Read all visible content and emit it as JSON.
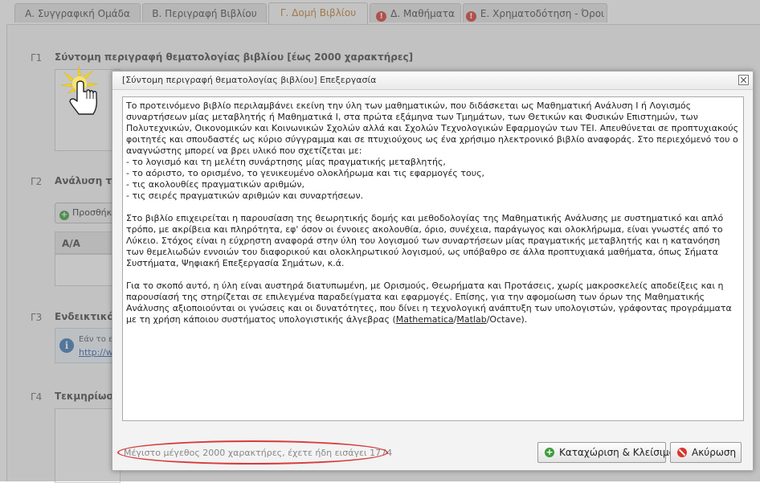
{
  "tabs": [
    {
      "label": "Α. Συγγραφική Ομάδα",
      "active": false,
      "warning": false
    },
    {
      "label": "Β. Περιγραφή Βιβλίου",
      "active": false,
      "warning": false
    },
    {
      "label": "Γ. Δομή Βιβλίου",
      "active": true,
      "warning": false
    },
    {
      "label": "Δ. Μαθήματα",
      "active": false,
      "warning": true
    },
    {
      "label": "Ε. Χρηματοδότηση - Όροι",
      "active": false,
      "warning": true
    }
  ],
  "background": {
    "s1": {
      "num": "Γ1",
      "title": "Σύντομη περιγραφή θεματολογίας βιβλίου [έως 2000 χαρακτήρες]"
    },
    "s2": {
      "num": "Γ2",
      "title": "Ανάλυση τ",
      "add_button": "Προσθήκ",
      "col_aa": "Α/Α"
    },
    "s3": {
      "num": "Γ3",
      "title": "Ενδεικτικό",
      "info_text": "Εάν το ε",
      "info_link": "http://w"
    },
    "s4": {
      "num": "Γ4",
      "title": "Τεκμηρίωσ"
    }
  },
  "modal": {
    "title": "[Σύντομη περιγραφή θεματολογίας βιβλίου] Επεξεργασία",
    "paragraphs": {
      "p1": "Το προτεινόμενο βιβλίο περιλαμβάνει εκείνη την ύλη των μαθηματικών, που διδάσκεται ως Μαθηματική Ανάλυση Ι ή Λογισμός συναρτήσεων μίας μεταβλητής ή Μαθηματικά Ι, στα πρώτα εξάμηνα των Τμημάτων, των Θετικών και Φυσικών Επιστημών, των Πολυτεχνικών, Οικονομικών και Κοινωνικών Σχολών αλλά και Σχολών Τεχνολογικών Εφαρμογών των ΤΕΙ. Απευθύνεται σε προπτυχιακούς φοιτητές και σπουδαστές ως κύριο σύγγραμμα και σε πτυχιούχους ως ένα χρήσιμο ηλεκτρονικό βιβλίο αναφοράς. Στο περιεχόμενό του ο αναγνώστης μπορεί να βρει υλικό που σχετίζεται με:\n- το λογισμό και τη μελέτη συνάρτησης μίας πραγματικής μεταβλητής,\n- το αόριστο, το ορισμένο, το γενικευμένο ολοκλήρωμα και τις εφαρμογές τους,\n- τις ακολουθίες πραγματικών αριθμών,\n- τις σειρές πραγματικών αριθμών και συναρτήσεων.",
      "p2": "Στο βιβλίο επιχειρείται η παρουσίαση της θεωρητικής δομής και μεθοδολογίας της Μαθηματικής Ανάλυσης με συστηματικό και απλό τρόπο, με ακρίβεια και πληρότητα, εφ' όσον οι έννοιες ακολουθία, όριο, συνέχεια, παράγωγος και ολοκλήρωμα, είναι γνωστές από το Λύκειο. Στόχος είναι η εύχρηστη αναφορά στην ύλη του λογισμού των συναρτήσεων μίας πραγματικής μεταβλητής και η κατανόηση των θεμελιωδών εννοιών του διαφορικού και ολοκληρωτικού λογισμού, ως υπόβαθρο σε άλλα προπτυχιακά μαθήματα, όπως Σήματα Συστήματα, Ψηφιακή Επεξεργασία Σημάτων, κ.ά.",
      "p3_start": "Για το σκοπό αυτό, η ύλη είναι αυστηρά διατυπωμένη, με Ορισμούς, Θεωρήματα και Προτάσεις, χωρίς μακροσκελείς αποδείξεις και η παρουσίασή της στηρίζεται σε επιλεγμένα παραδείγματα και εφαρμογές. Επίσης, για την αφομοίωση των όρων της Μαθηματικής Ανάλυσης αξιοποιούνται οι γνώσεις και οι δυνατότητες, που δίνει η τεχνολογική ανάπτυξη των υπολογιστών, γράφοντας προγράμματα με τη χρήση κάποιου συστήματος υπολογιστικής άλγεβρας (",
      "p3_w1": "Mathematica",
      "p3_s1": "/",
      "p3_w2": "Matlab",
      "p3_end": "/Octave)."
    },
    "char_note": "Μέγιστο μέγεθος 2000 χαρακτήρες, έχετε ήδη εισάγει 1774",
    "save_button": "Καταχώριση & Κλείσιμο",
    "cancel_button": "Ακύρωση",
    "warning_glyph": "!",
    "plus_glyph": "+",
    "info_glyph": "i"
  }
}
